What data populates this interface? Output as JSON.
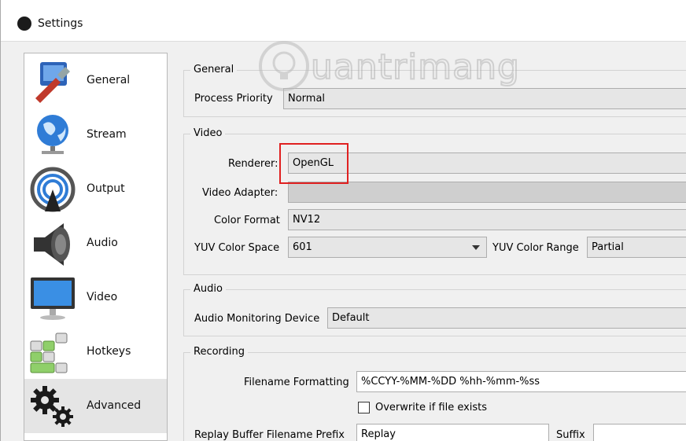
{
  "window": {
    "title": "Settings"
  },
  "sidebar": {
    "items": [
      {
        "label": "General",
        "icon": "general-icon",
        "selected": false
      },
      {
        "label": "Stream",
        "icon": "globe-icon",
        "selected": false
      },
      {
        "label": "Output",
        "icon": "broadcast-icon",
        "selected": false
      },
      {
        "label": "Audio",
        "icon": "speaker-icon",
        "selected": false
      },
      {
        "label": "Video",
        "icon": "monitor-icon",
        "selected": false
      },
      {
        "label": "Hotkeys",
        "icon": "keyboard-icon",
        "selected": false
      },
      {
        "label": "Advanced",
        "icon": "gears-icon",
        "selected": true
      }
    ]
  },
  "general": {
    "title": "General",
    "process_priority_label": "Process Priority",
    "process_priority_value": "Normal"
  },
  "video": {
    "title": "Video",
    "renderer_label": "Renderer:",
    "renderer_value": "OpenGL",
    "video_adapter_label": "Video Adapter:",
    "video_adapter_value": "",
    "color_format_label": "Color Format",
    "color_format_value": "NV12",
    "yuv_color_space_label": "YUV Color Space",
    "yuv_color_space_value": "601",
    "yuv_color_range_label": "YUV Color Range",
    "yuv_color_range_value": "Partial"
  },
  "audio": {
    "title": "Audio",
    "monitoring_device_label": "Audio Monitoring Device",
    "monitoring_device_value": "Default"
  },
  "recording": {
    "title": "Recording",
    "filename_formatting_label": "Filename Formatting",
    "filename_formatting_value": "%CCYY-%MM-%DD %hh-%mm-%ss",
    "overwrite_label": "Overwrite if file exists",
    "overwrite_checked": false,
    "replay_prefix_label": "Replay Buffer Filename Prefix",
    "replay_prefix_value": "Replay",
    "suffix_label": "Suffix",
    "suffix_value": ""
  },
  "watermark": {
    "text": "uantrimang"
  },
  "colors": {
    "highlight": "#e02020",
    "selected_bg": "#e5e5e5"
  }
}
